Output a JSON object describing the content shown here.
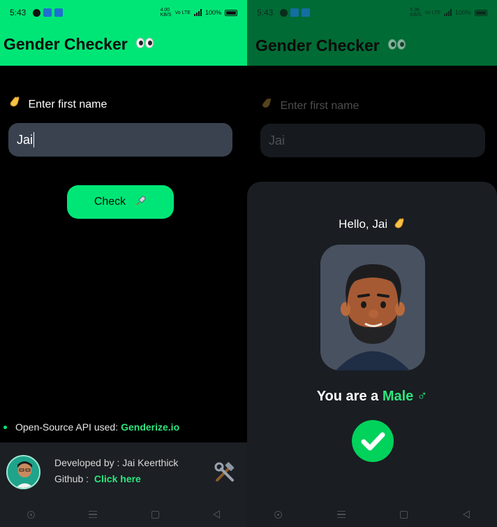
{
  "status_bar": {
    "time": "5:43",
    "net_speed": "4.00\nKB/S",
    "network": "VoLTE 4G",
    "battery": "100%"
  },
  "app": {
    "title": "Gender Checker",
    "title_emoji": "eyes-icon",
    "accent_color": "#00e676"
  },
  "form": {
    "label": "Enter first name",
    "label_emoji": "waving-hand-icon",
    "input_value": "Jai",
    "button_label": "Check",
    "button_icon": "rocket-icon"
  },
  "api": {
    "prefix": "Open-Source API used:",
    "link": "Genderize.io"
  },
  "developer": {
    "line1": "Developed by : Jai Keerthick",
    "github_prefix": "Github :",
    "github_link": "Click here",
    "tools_icon": "hammer-wrench-icon"
  },
  "result_sheet": {
    "greeting": "Hello, Jai",
    "greeting_emoji": "waving-hand-icon",
    "result_prefix": "You are a",
    "gender": "Male",
    "gender_symbol": "♂",
    "confirm_icon": "check-circle-icon"
  },
  "nav_bar": [
    "assistant-icon",
    "menu-icon",
    "home-square-icon",
    "back-triangle-icon"
  ]
}
